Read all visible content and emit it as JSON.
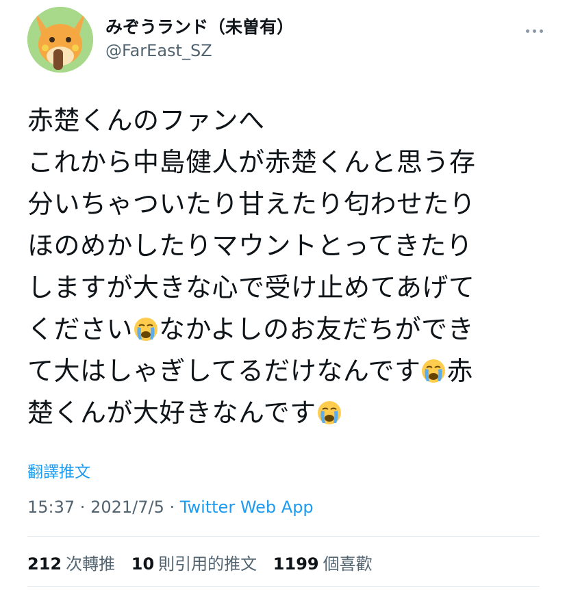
{
  "author": {
    "display_name": "みぞうランド（未曽有）",
    "handle": "@FarEast_SZ",
    "avatar_icon": "raichu-avatar"
  },
  "tweet": {
    "lines": [
      "赤楚くんのファンへ",
      "これから中島健人が赤楚くんと思う存",
      "分いちゃついたり甘えたり匂わせたり",
      "ほのめかしたりマウントとってきたり",
      "しますが大きな心で受け止めてあげて"
    ],
    "line6_a": "ください",
    "line6_b": "なかよしのお友だちができ",
    "line7_a": "て大はしゃぎしてるだけなんです",
    "line7_b": "赤",
    "line8_a": "楚くんが大好きなんです",
    "emoji_icon": "loudly-crying-face-emoji"
  },
  "translate_label": "翻譯推文",
  "meta": {
    "time": "15:37",
    "separator": " · ",
    "date": "2021/7/5",
    "source": "Twitter Web App"
  },
  "stats": {
    "retweets_count": "212",
    "retweets_label": "次轉推",
    "quotes_count": "10",
    "quotes_label": "則引用的推文",
    "likes_count": "1199",
    "likes_label": "個喜歡"
  },
  "colors": {
    "link": "#1d9bf0",
    "secondary_text": "#536471",
    "primary_text": "#0f1419",
    "divider": "#e1e8ed"
  }
}
